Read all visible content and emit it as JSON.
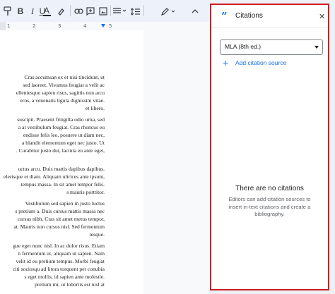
{
  "toolbar": {
    "bold": "B",
    "italic": "I",
    "underline": "U",
    "text_color": "A",
    "items": [
      "paint-format",
      "bold",
      "italic",
      "underline",
      "text-color",
      "highlight",
      "insert-link",
      "add-comment",
      "insert-image",
      "align",
      "line-spacing",
      "edit-mode"
    ]
  },
  "ruler": {
    "ticks": [
      "1",
      "2",
      "3",
      "4",
      "5"
    ]
  },
  "document": {
    "paragraphs": [
      [
        "Cras accumsan ex et nisi tincidunt, ut",
        "sed laoreet. Vivamus feugiat a velit ac",
        "ellentesque sapien risus, sagittis non arcu",
        "eros, a venenatis ligula dignissim vitae.",
        "et libero."
      ],
      [
        "suscipit. Praesent fringilla odio urna, sed",
        "a at vestibulum feugiat. Cras rhoncus eu",
        "endisse felis leo, posuere ut diam nec,",
        "a blandit elementum eget nec justo. Ut",
        ". Curabitur justo dui, lacinia eu ante eget,"
      ],
      [
        "uctus arcu. Duis mattis dapibus dapibus.",
        "elerisque et diam. Aliquam ultrices ante ipsum,",
        "tempus massa. In sit amet tempor felis.",
        "s mauris porttitor."
      ],
      [
        "Vestibulum sed sapien in justo luctus",
        "s pretium a. Duis cursus mattis massa nec",
        "cursus nibh. Cras sit amet metus tempor,",
        "at. Mauris non cursus nisl. Sed fermentum",
        "tesque."
      ],
      [
        "gue eget nunc nisl. In ac dolor risus. Etiam",
        "n fermentum ut, aliquam ut sapien. Nam",
        "velit id eu pretium tempus. Morbi feugiat",
        "citi sociosqu ad litora torquent per conubia",
        "s eget mollis, id sapien ante molestie.",
        "pretium mi, ut lobortis est nisl at"
      ]
    ]
  },
  "citations_panel": {
    "title": "Citations",
    "close_icon": "close-icon",
    "style_value": "MLA (8th ed.)",
    "add_source_label": "Add citation source",
    "empty_title": "There are no citations",
    "empty_text": "Editors can add citation sources to insert in-text citations and create a bibliography.",
    "accent_color": "#1a73e8",
    "border_color": "#cc1f24"
  }
}
